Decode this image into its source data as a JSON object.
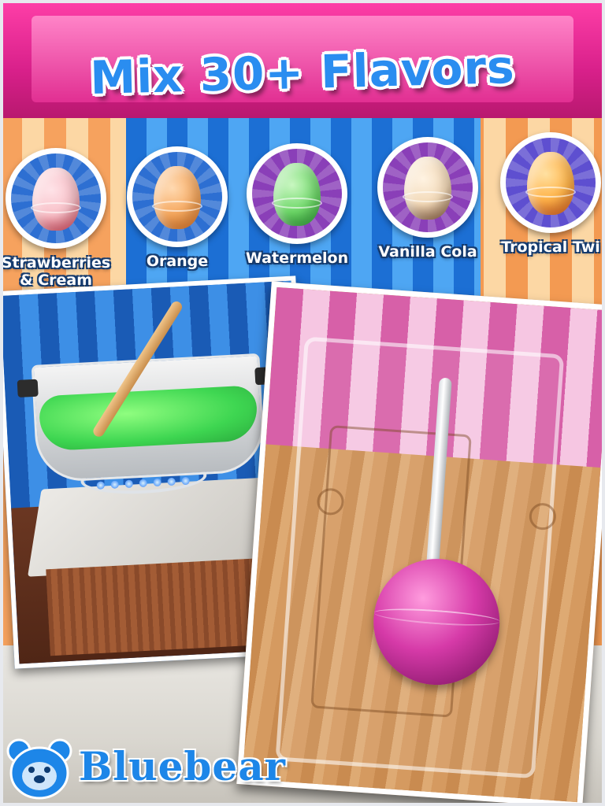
{
  "title": "Mix 30+ Flavors",
  "flavors": [
    {
      "label": "Strawberries & Cream",
      "bg": "#2d6fd2",
      "candy": "#f8c0c8",
      "swirl": "#e8435a"
    },
    {
      "label": "Orange",
      "bg": "#2d6fd2",
      "candy": "#f5a55a",
      "swirl": "#ec7a25"
    },
    {
      "label": "Watermelon",
      "bg": "#8a3fb8",
      "candy": "#6bd766",
      "swirl": "#2fa83a"
    },
    {
      "label": "Vanilla Cola",
      "bg": "#8a3fb8",
      "candy": "#f2d9b8",
      "swirl": "#8a5a3a"
    },
    {
      "label": "Tropical Twi",
      "bg": "#5e4fd0",
      "candy": "#ffb44a",
      "swirl": "#e8601e"
    }
  ],
  "brand": {
    "name": "Bluebear",
    "icon": "bear-icon",
    "color": "#1d86e8"
  },
  "colors": {
    "title": "#2a8df0",
    "ceiling": "#e12f92",
    "lollipop": "#d63aa8",
    "liquid": "#36d64a"
  }
}
